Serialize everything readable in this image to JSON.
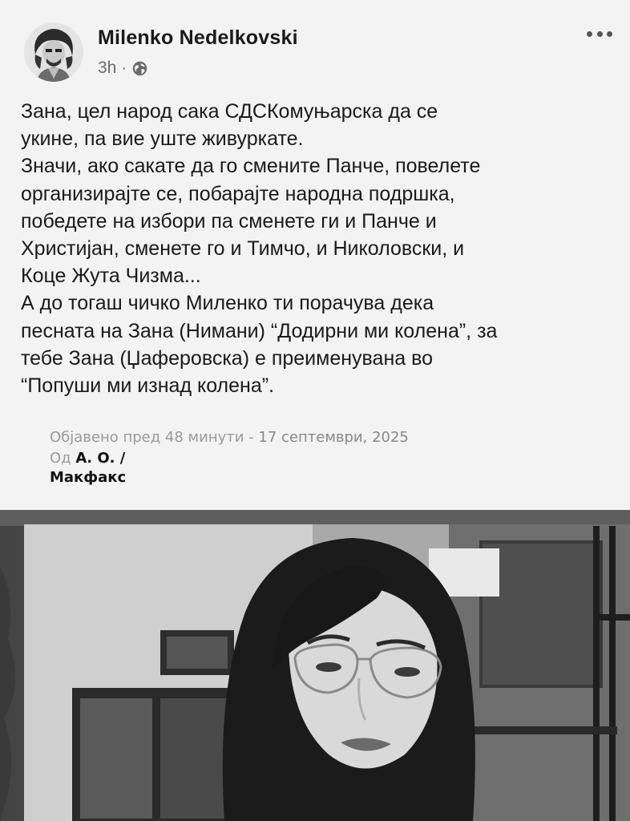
{
  "post": {
    "author": "Milenko Nedelkovski",
    "time": "3h",
    "separator": "·",
    "icons": {
      "avatar": "avatar-illustration",
      "visibility": "globe-icon",
      "more": "more-options-icon"
    },
    "body_lines": [
      "Зана, цел народ сака СДСКомуњарска да се",
      "укине, па вие уште живуркате.",
      "Значи, ако сакате да го смените Панче, повелете",
      "организирајте се, побарајте народна подршка,",
      "победете на избори па сменете ги и Панче и",
      "Христијан, сменете го и Тимчо, и Николовски, и",
      "Коце Жута Чизма...",
      "А до тогаш чичко Миленко ти порачува дека",
      "песната на Зана (Нимани) “Додирни ми колена”, за",
      "тебе Зана (Џаферовска) е преименувана во",
      "“Попуши ми изнад колена”."
    ]
  },
  "article": {
    "published_prefix": "Објавено пред 48 минути",
    "published_sep": " - ",
    "published_date": "17 септември, 2025",
    "by_prefix": "Од ",
    "author": "А. О. /",
    "agency": "Макфакс"
  }
}
